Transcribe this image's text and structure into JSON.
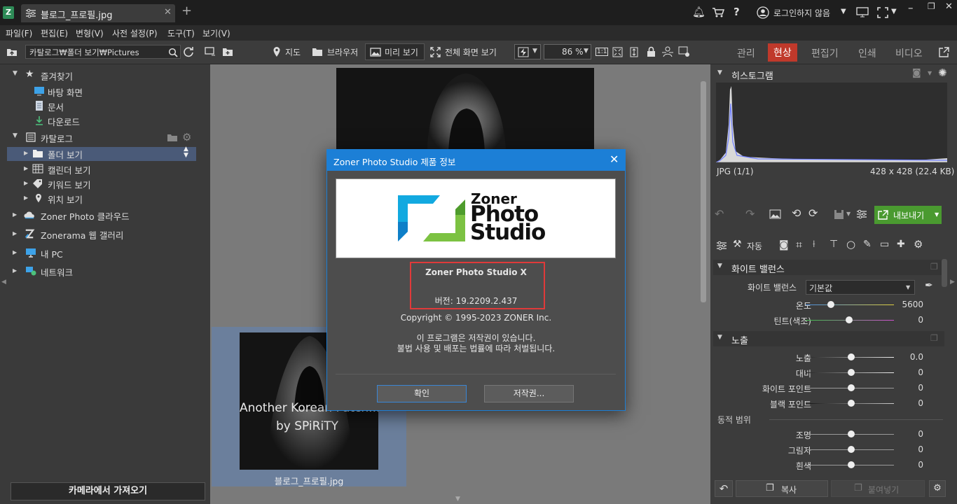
{
  "titlebar": {
    "tab_label": "블로그_프로필.jpg",
    "login": "로그인하지 않음"
  },
  "menu": [
    "파일(F)",
    "편집(E)",
    "변형(V)",
    "사전 설정(P)",
    "도구(T)",
    "보기(V)"
  ],
  "toolbar": {
    "path": "카탈로그₩폴더 보기₩Pictures",
    "map": "지도",
    "browser": "브라우저",
    "preview": "미리 보기",
    "fullscreen": "전체 화면 보기",
    "zoom": "86 %",
    "zoom_1to1": "1:1",
    "modes": {
      "manage": "관리",
      "develop": "현상",
      "editor": "편집기",
      "print": "인쇄",
      "video": "비디오"
    }
  },
  "left": {
    "favorites": "즐겨찾기",
    "desktop": "바탕 화면",
    "documents": "문서",
    "downloads": "다운로드",
    "catalog": "카탈로그",
    "folder_view": "폴더 보기",
    "calendar_view": "캘린더 보기",
    "keyword_view": "키워드 보기",
    "location_view": "위치 보기",
    "zoner_cloud": "Zoner Photo 클라우드",
    "zonerama": "Zonerama 웹 갤러리",
    "my_pc": "내 PC",
    "network": "네트워크",
    "import": "카메라에서 가져오기"
  },
  "center": {
    "thumb_text1": "Another Korean Patch...",
    "thumb_text2": "by SPiRiTY",
    "thumb_name": "블로그_프로필.jpg"
  },
  "dialog": {
    "title": "Zoner Photo Studio 제품 정보",
    "logo_word1": "Zoner",
    "logo_word2": "Photo",
    "logo_word3": "Studio",
    "product": "Zoner Photo Studio X",
    "version": "버전: 19.2209.2.437",
    "copyright": "Copyright © 1995-2023 ZONER Inc.",
    "notice1": "이 프로그램은 저작권이 있습니다.",
    "notice2": "불법 사용 및 배포는 법률에 따라 처벌됩니다.",
    "ok": "확인",
    "copyright_btn": "저작권..."
  },
  "right": {
    "histogram": "히스토그램",
    "format": "JPG  (1/1)",
    "dims": "428 x 428 (22.4 KB)",
    "export": "내보내기",
    "auto": "자동",
    "wb_section": "화이트 밸런스",
    "wb_label": "화이트 밸런스",
    "wb_value": "기본값",
    "temp_label": "온도",
    "temp_value": "5600",
    "tint_label": "틴트(색조)",
    "tint_value": "0",
    "exposure_section": "노출",
    "exposure_label": "노출",
    "exposure_value": "0.0",
    "contrast_label": "대비",
    "contrast_value": "0",
    "white_label": "화이트 포인트",
    "white_value": "0",
    "black_label": "블랙 포인트",
    "black_value": "0",
    "dyn_range": "동적 범위",
    "lights_label": "조명",
    "lights_value": "0",
    "shadows_label": "그림자",
    "shadows_value": "0",
    "whites_label": "흰색",
    "whites_value": "0",
    "copy": "복사",
    "paste": "붙여넣기"
  }
}
